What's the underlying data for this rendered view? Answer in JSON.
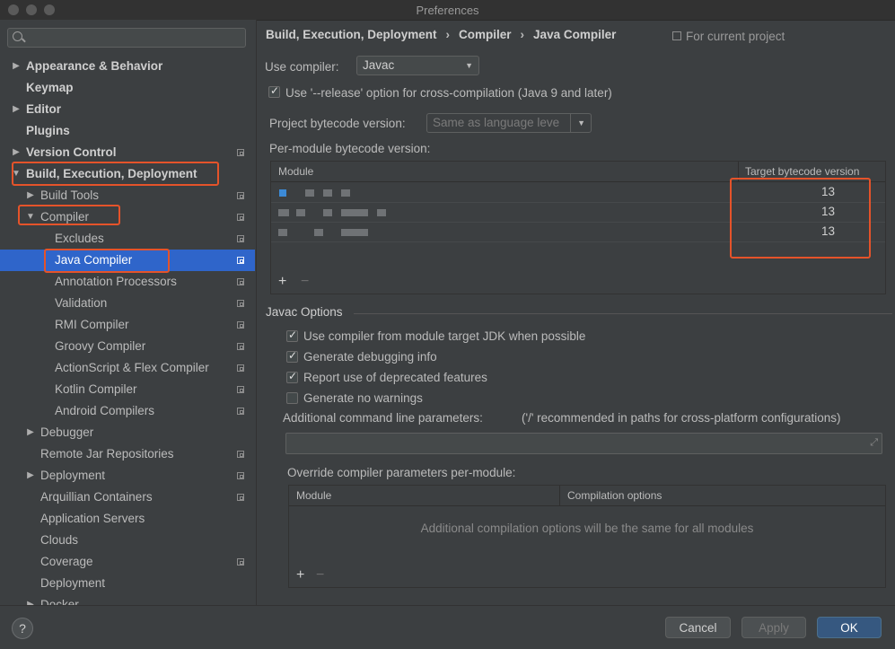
{
  "window": {
    "title": "Preferences"
  },
  "sidebar": {
    "search_placeholder": "",
    "items": [
      {
        "label": "Appearance & Behavior",
        "arrow": "▶",
        "bold": true,
        "proj": false
      },
      {
        "label": "Keymap",
        "arrow": "",
        "bold": true,
        "proj": false
      },
      {
        "label": "Editor",
        "arrow": "▶",
        "bold": true,
        "proj": false
      },
      {
        "label": "Plugins",
        "arrow": "",
        "bold": true,
        "proj": false
      },
      {
        "label": "Version Control",
        "arrow": "▶",
        "bold": true,
        "proj": true
      },
      {
        "label": "Build, Execution, Deployment",
        "arrow": "▼",
        "bold": true,
        "proj": false
      },
      {
        "label": "Build Tools",
        "arrow": "▶",
        "bold": false,
        "proj": true
      },
      {
        "label": "Compiler",
        "arrow": "▼",
        "bold": false,
        "proj": true
      },
      {
        "label": "Excludes",
        "arrow": "",
        "bold": false,
        "proj": true
      },
      {
        "label": "Java Compiler",
        "arrow": "",
        "bold": false,
        "proj": true,
        "selected": true
      },
      {
        "label": "Annotation Processors",
        "arrow": "",
        "bold": false,
        "proj": true
      },
      {
        "label": "Validation",
        "arrow": "",
        "bold": false,
        "proj": true
      },
      {
        "label": "RMI Compiler",
        "arrow": "",
        "bold": false,
        "proj": true
      },
      {
        "label": "Groovy Compiler",
        "arrow": "",
        "bold": false,
        "proj": true
      },
      {
        "label": "ActionScript & Flex Compiler",
        "arrow": "",
        "bold": false,
        "proj": true
      },
      {
        "label": "Kotlin Compiler",
        "arrow": "",
        "bold": false,
        "proj": true
      },
      {
        "label": "Android Compilers",
        "arrow": "",
        "bold": false,
        "proj": true
      },
      {
        "label": "Debugger",
        "arrow": "▶",
        "bold": false,
        "proj": false
      },
      {
        "label": "Remote Jar Repositories",
        "arrow": "",
        "bold": false,
        "proj": true
      },
      {
        "label": "Deployment",
        "arrow": "▶",
        "bold": false,
        "proj": true
      },
      {
        "label": "Arquillian Containers",
        "arrow": "",
        "bold": false,
        "proj": true
      },
      {
        "label": "Application Servers",
        "arrow": "",
        "bold": false,
        "proj": false
      },
      {
        "label": "Clouds",
        "arrow": "",
        "bold": false,
        "proj": false
      },
      {
        "label": "Coverage",
        "arrow": "",
        "bold": false,
        "proj": true
      },
      {
        "label": "Deployment",
        "arrow": "",
        "bold": false,
        "proj": false
      },
      {
        "label": "Docker",
        "arrow": "▶",
        "bold": false,
        "proj": false
      }
    ]
  },
  "breadcrumb": {
    "parts": [
      "Build, Execution, Deployment",
      "Compiler",
      "Java Compiler"
    ],
    "separator": "›",
    "scope": "For current project"
  },
  "compiler": {
    "use_compiler_label": "Use compiler:",
    "use_compiler_value": "Javac",
    "release_option_label": "Use '--release' option for cross-compilation (Java 9 and later)",
    "release_option_checked": true,
    "project_bytecode_label": "Project bytecode version:",
    "project_bytecode_value": "Same as language leve",
    "per_module_label": "Per-module bytecode version:",
    "module_table": {
      "headers": [
        "Module",
        "Target bytecode version"
      ],
      "rows": [
        {
          "module": "",
          "target": "13"
        },
        {
          "module": "",
          "target": "13"
        },
        {
          "module": "",
          "target": "13"
        }
      ],
      "add": "+",
      "remove": "−"
    }
  },
  "javac": {
    "section_title": "Javac Options",
    "options": [
      {
        "label": "Use compiler from module target JDK when possible",
        "checked": true
      },
      {
        "label": "Generate debugging info",
        "checked": true
      },
      {
        "label": "Report use of deprecated features",
        "checked": true
      },
      {
        "label": "Generate no warnings",
        "checked": false
      }
    ],
    "additional_params_label": "Additional command line parameters:",
    "additional_params_hint": "('/' recommended in paths for cross-platform configurations)",
    "additional_params_value": "",
    "override_label": "Override compiler parameters per-module:",
    "override_table": {
      "headers": [
        "Module",
        "Compilation options"
      ],
      "empty_text": "Additional compilation options will be the same for all modules",
      "add": "+",
      "remove": "−"
    }
  },
  "buttons": {
    "help": "?",
    "cancel": "Cancel",
    "apply": "Apply",
    "ok": "OK"
  },
  "colors": {
    "accent": "#2f65ca",
    "highlight": "#e5532a",
    "primary_button": "#365880"
  }
}
